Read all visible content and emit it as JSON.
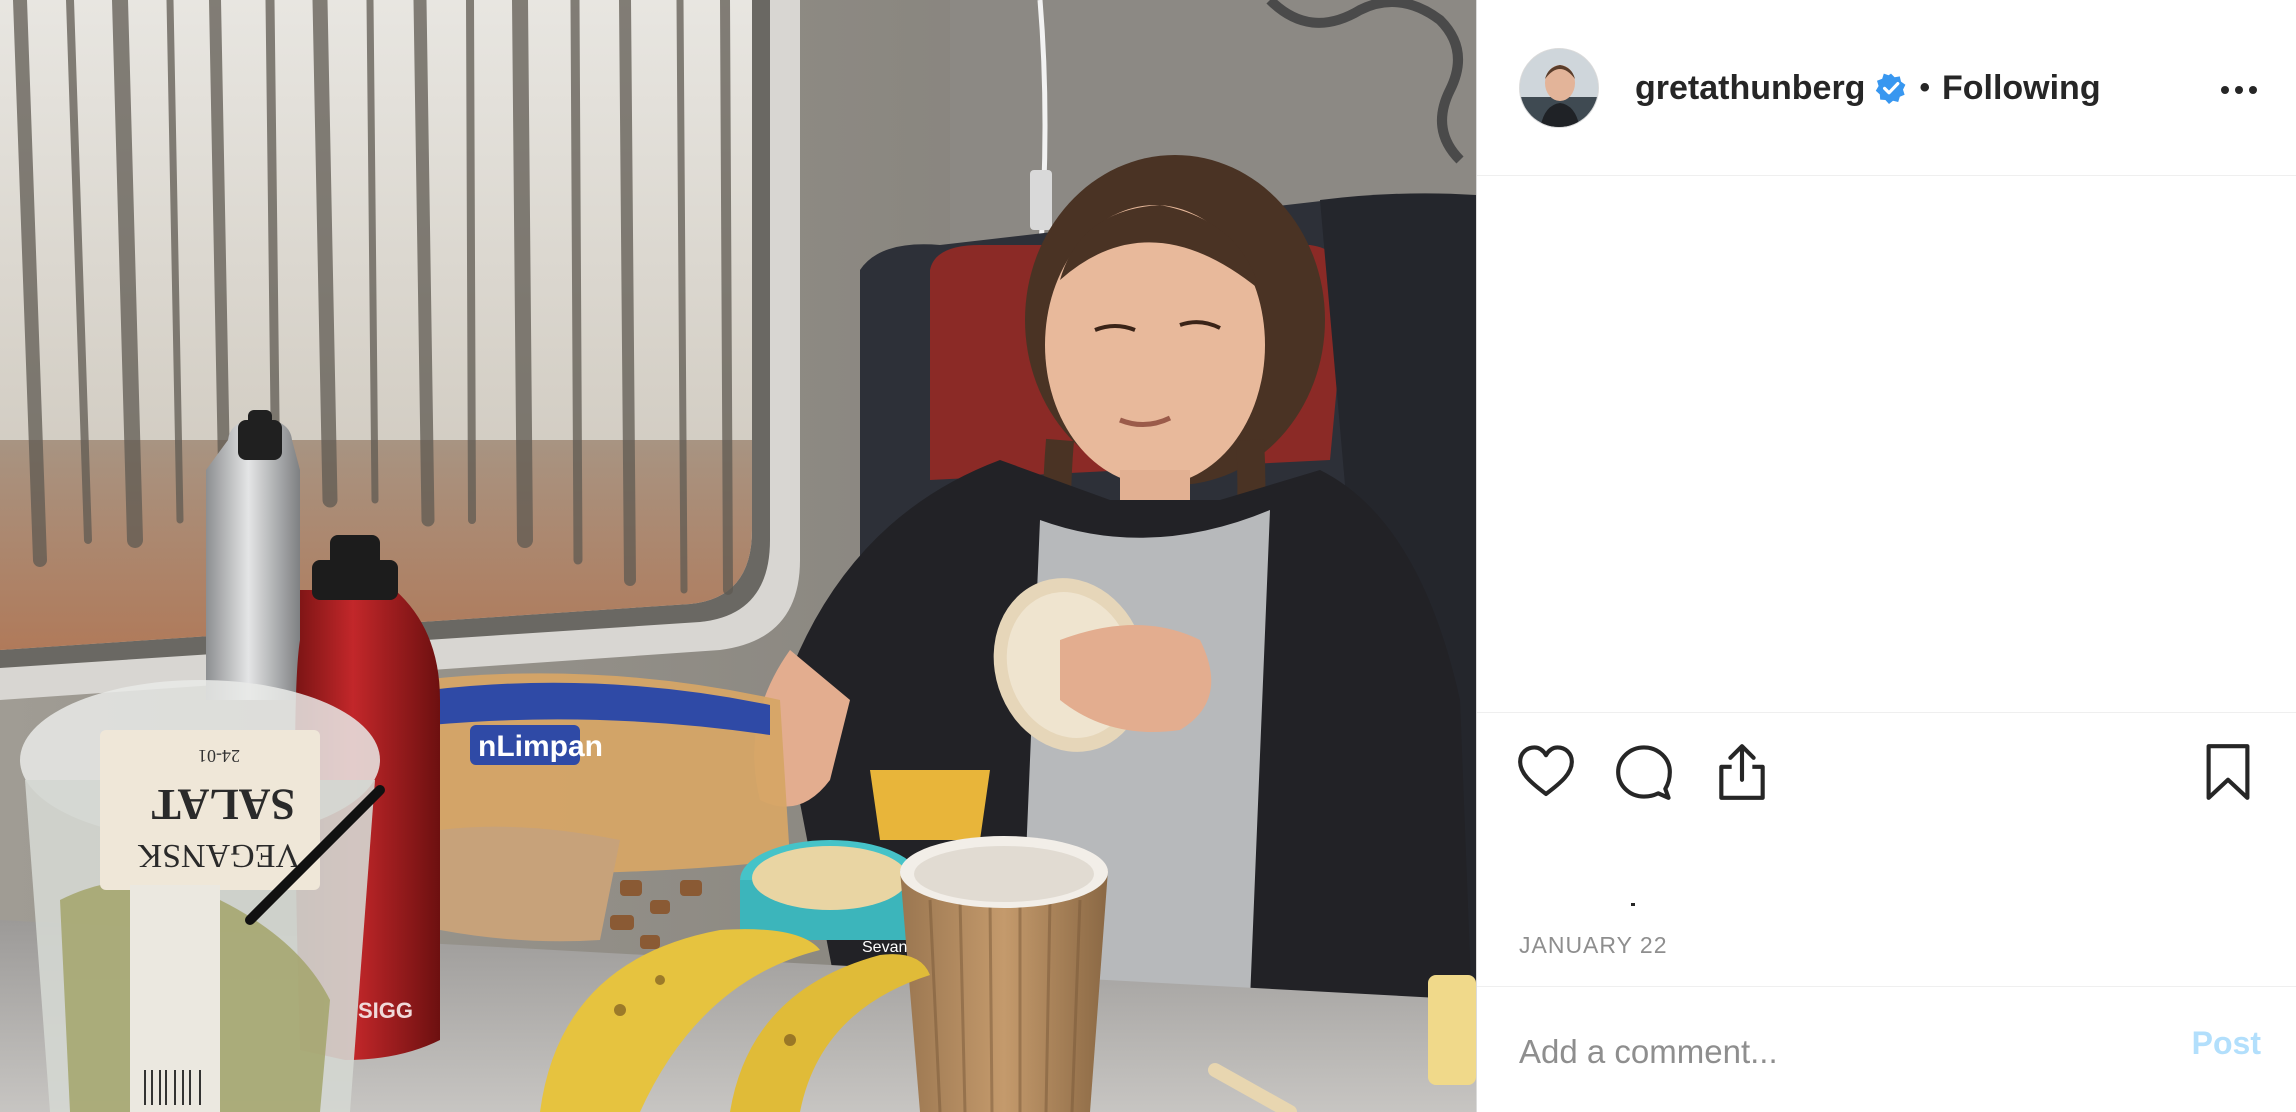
{
  "post": {
    "username": "gretathunberg",
    "separator": "•",
    "follow_status": "Following",
    "date": "JANUARY 22",
    "liked": false,
    "saved": false
  },
  "photo_text": {
    "bread_label": "nLimpan",
    "salad_line1": "SALAT",
    "salad_line2": "VEGANSK",
    "salad_code": "24-01",
    "bottle_brand": "SIGG",
    "hummus_label": "Sevan"
  },
  "comment": {
    "placeholder": "Add a comment...",
    "post_label": "Post"
  },
  "icons": {
    "verified": "verified-badge-icon",
    "more": "more-options-icon",
    "like": "heart-icon",
    "comment": "comment-bubble-icon",
    "share": "share-icon",
    "save": "bookmark-icon"
  },
  "colors": {
    "verified_blue": "#3897f0",
    "post_disabled": "#b2dffc",
    "muted_text": "#8e8e8e",
    "border": "#dbdbdb"
  }
}
